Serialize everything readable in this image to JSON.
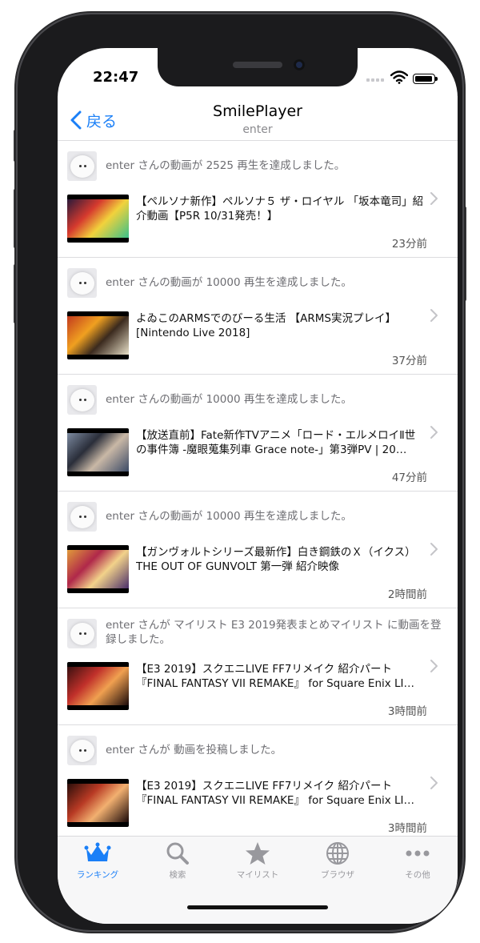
{
  "status": {
    "time": "22:47"
  },
  "nav": {
    "back_label": "戻る",
    "title": "SmilePlayer",
    "subtitle": "enter"
  },
  "entries": [
    {
      "message": "enter さんの動画が 2525 再生を達成しました。",
      "title": "【ペルソナ新作】ペルソナ５ ザ・ロイヤル 「坂本竜司」紹介動画【P5R 10/31発売！】",
      "time": "23分前",
      "thumb_colors": [
        "#2a1a3a",
        "#d63a2e",
        "#f2d23c",
        "#3ac08a"
      ]
    },
    {
      "message": "enter さんの動画が 10000 再生を達成しました。",
      "title": "よゐこのARMSでのびーる生活 【ARMS実況プレイ】[Nintendo Live 2018]",
      "time": "37分前",
      "thumb_colors": [
        "#c23a1e",
        "#f0a020",
        "#3b2a1e",
        "#e8e0c8"
      ]
    },
    {
      "message": "enter さんの動画が 10000 再生を達成しました。",
      "title": "【放送直前】Fate新作TVアニメ「ロード・エルメロイⅡ世の事件簿 -魔眼蒐集列車 Grace note-」第3弾PV | 20…",
      "time": "47分前",
      "thumb_colors": [
        "#7c8aa0",
        "#2a2e3a",
        "#c9b8a6",
        "#3b4a66"
      ]
    },
    {
      "message": "enter さんの動画が 10000 再生を達成しました。",
      "title": "【ガンヴォルトシリーズ最新作】白き鋼鉄のＸ（イクス）THE OUT OF GUNVOLT 第一弾 紹介映像",
      "time": "2時間前",
      "thumb_colors": [
        "#e09a3a",
        "#b0284a",
        "#f2d28a",
        "#4a2e6a"
      ]
    },
    {
      "message": "enter さんが マイリスト E3 2019発表まとめマイリスト に動画を登録しました。",
      "title": "【E3 2019】スクエニLIVE FF7リメイク 紹介パート 『FINAL FANTASY VII REMAKE』 for Square Enix LI…",
      "time": "3時間前",
      "thumb_colors": [
        "#3a1010",
        "#c0302a",
        "#f0a050",
        "#1a0a0a"
      ]
    },
    {
      "message": "enter さんが 動画を投稿しました。",
      "title": "【E3 2019】スクエニLIVE FF7リメイク 紹介パート 『FINAL FANTASY VII REMAKE』 for Square Enix LI…",
      "time": "3時間前",
      "thumb_colors": [
        "#2a0e0a",
        "#b83a24",
        "#f2b070",
        "#1a0808"
      ]
    }
  ],
  "tabs": [
    {
      "label": "ランキング",
      "icon": "crown-icon",
      "active": true
    },
    {
      "label": "検索",
      "icon": "search-icon",
      "active": false
    },
    {
      "label": "マイリスト",
      "icon": "star-icon",
      "active": false
    },
    {
      "label": "ブラウザ",
      "icon": "globe-icon",
      "active": false
    },
    {
      "label": "その他",
      "icon": "more-icon",
      "active": false
    }
  ],
  "colors": {
    "accent": "#1a7ff7",
    "inactive": "#98989d"
  }
}
